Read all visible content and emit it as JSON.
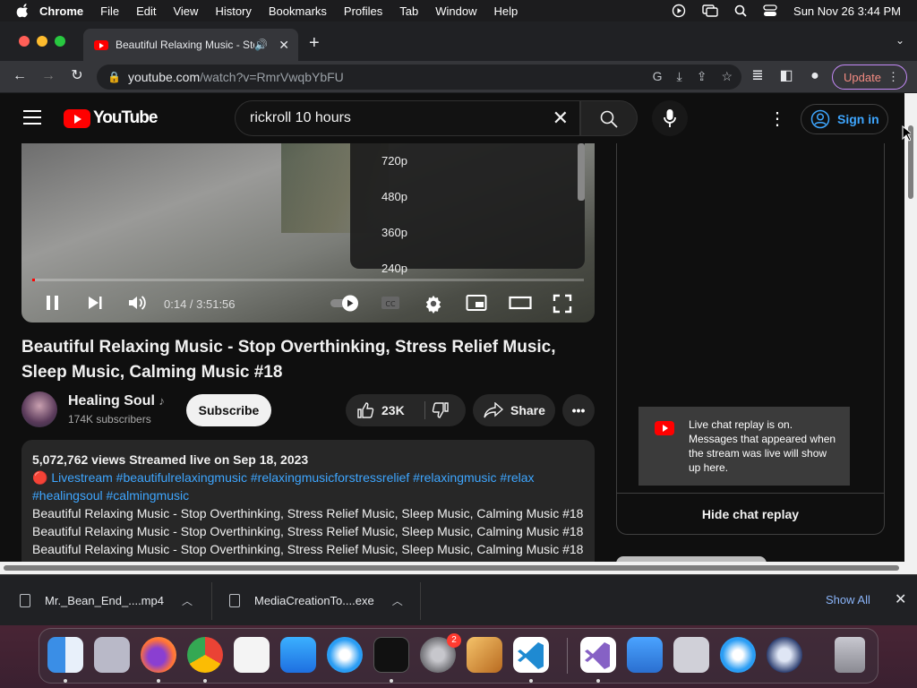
{
  "menubar": {
    "app": "Chrome",
    "items": [
      "File",
      "Edit",
      "View",
      "History",
      "Bookmarks",
      "Profiles",
      "Tab",
      "Window",
      "Help"
    ],
    "datetime": "Sun Nov 26  3:44 PM"
  },
  "browser": {
    "tab_title": "Beautiful Relaxing Music - Stop Overthinking",
    "url_host": "youtube.com",
    "url_path": "/watch?v=RmrVwqbYbFU",
    "update_label": "Update"
  },
  "youtube": {
    "logo_text": "YouTube",
    "search_value": "rickroll 10 hours",
    "sign_in": "Sign in",
    "quality_options": [
      "720p",
      "480p",
      "360p",
      "240p"
    ],
    "time": "0:14 / 3:51:56",
    "progress_fraction": 0.001,
    "title": "Beautiful Relaxing Music - Stop Overthinking, Stress Relief Music, Sleep Music, Calming Music #18",
    "channel_name": "Healing Soul",
    "channel_note": "♪",
    "subscribers": "174K subscribers",
    "subscribe_label": "Subscribe",
    "likes": "23K",
    "share_label": "Share",
    "description": {
      "stats": "5,072,762 views  Streamed live on Sep 18, 2023",
      "live_dot": "🔴",
      "tags_line1": "Livestream #beautifulrelaxingmusic #relaxingmusicforstressrelief #relaxingmusic #relax",
      "tags_line2": "#healingsoul #calmingmusic",
      "lines": [
        "Beautiful Relaxing Music - Stop Overthinking, Stress Relief Music, Sleep Music, Calming Music #18",
        "Beautiful Relaxing Music - Stop Overthinking, Stress Relief Music, Sleep Music, Calming Music #18",
        "Beautiful Relaxing Music - Stop Overthinking, Stress Relief Music, Sleep Music, Calming Music #18"
      ]
    },
    "chat_replay_message": "Live chat replay is on. Messages that appeared when the stream was live will show up here.",
    "hide_chat": "Hide chat replay"
  },
  "downloads": {
    "items": [
      "Mr._Bean_End_....mp4",
      "MediaCreationTo....exe"
    ],
    "show_all": "Show All"
  },
  "dock": {
    "settings_badge": "2",
    "apps": [
      "finder-icon",
      "launchpad-icon",
      "firefox-icon",
      "chrome-icon",
      "textedit-icon",
      "app-store-icon",
      "safari-icon",
      "terminal-icon",
      "system-settings-icon",
      "garageband-icon",
      "vscode-icon",
      "visual-studio-icon",
      "weather-icon",
      "downloads-stack-icon",
      "safari-2-icon",
      "quicktime-icon",
      "trash-icon"
    ],
    "colors": {
      "finder": "#3a8ee6",
      "launchpad": "#b9b9c8",
      "firefox": "#ff7139",
      "chrome": "#f2f2f2",
      "textedit": "#f4f4f4",
      "app_store": "#1e8ef2",
      "safari": "#2a9df4",
      "terminal": "#111111",
      "settings": "#8e8e93",
      "garageband": "#e0a040",
      "vscode": "#ffffff",
      "visual_studio": "#ffffff",
      "weather": "#4aa3ff",
      "downloads": "#d0d0d8",
      "quicktime": "#2c3e70",
      "trash": "#a0a0a8"
    }
  }
}
